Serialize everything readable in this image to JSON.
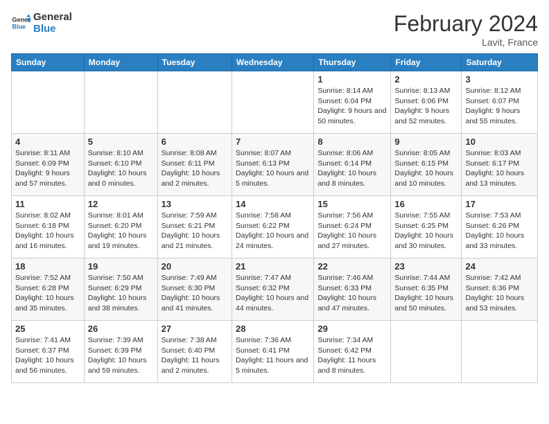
{
  "header": {
    "logo_general": "General",
    "logo_blue": "Blue",
    "month_title": "February 2024",
    "location": "Lavit, France"
  },
  "days_of_week": [
    "Sunday",
    "Monday",
    "Tuesday",
    "Wednesday",
    "Thursday",
    "Friday",
    "Saturday"
  ],
  "weeks": [
    [
      {
        "day": "",
        "info": ""
      },
      {
        "day": "",
        "info": ""
      },
      {
        "day": "",
        "info": ""
      },
      {
        "day": "",
        "info": ""
      },
      {
        "day": "1",
        "info": "Sunrise: 8:14 AM\nSunset: 6:04 PM\nDaylight: 9 hours and 50 minutes."
      },
      {
        "day": "2",
        "info": "Sunrise: 8:13 AM\nSunset: 6:06 PM\nDaylight: 9 hours and 52 minutes."
      },
      {
        "day": "3",
        "info": "Sunrise: 8:12 AM\nSunset: 6:07 PM\nDaylight: 9 hours and 55 minutes."
      }
    ],
    [
      {
        "day": "4",
        "info": "Sunrise: 8:11 AM\nSunset: 6:09 PM\nDaylight: 9 hours and 57 minutes."
      },
      {
        "day": "5",
        "info": "Sunrise: 8:10 AM\nSunset: 6:10 PM\nDaylight: 10 hours and 0 minutes."
      },
      {
        "day": "6",
        "info": "Sunrise: 8:08 AM\nSunset: 6:11 PM\nDaylight: 10 hours and 2 minutes."
      },
      {
        "day": "7",
        "info": "Sunrise: 8:07 AM\nSunset: 6:13 PM\nDaylight: 10 hours and 5 minutes."
      },
      {
        "day": "8",
        "info": "Sunrise: 8:06 AM\nSunset: 6:14 PM\nDaylight: 10 hours and 8 minutes."
      },
      {
        "day": "9",
        "info": "Sunrise: 8:05 AM\nSunset: 6:15 PM\nDaylight: 10 hours and 10 minutes."
      },
      {
        "day": "10",
        "info": "Sunrise: 8:03 AM\nSunset: 6:17 PM\nDaylight: 10 hours and 13 minutes."
      }
    ],
    [
      {
        "day": "11",
        "info": "Sunrise: 8:02 AM\nSunset: 6:18 PM\nDaylight: 10 hours and 16 minutes."
      },
      {
        "day": "12",
        "info": "Sunrise: 8:01 AM\nSunset: 6:20 PM\nDaylight: 10 hours and 19 minutes."
      },
      {
        "day": "13",
        "info": "Sunrise: 7:59 AM\nSunset: 6:21 PM\nDaylight: 10 hours and 21 minutes."
      },
      {
        "day": "14",
        "info": "Sunrise: 7:58 AM\nSunset: 6:22 PM\nDaylight: 10 hours and 24 minutes."
      },
      {
        "day": "15",
        "info": "Sunrise: 7:56 AM\nSunset: 6:24 PM\nDaylight: 10 hours and 27 minutes."
      },
      {
        "day": "16",
        "info": "Sunrise: 7:55 AM\nSunset: 6:25 PM\nDaylight: 10 hours and 30 minutes."
      },
      {
        "day": "17",
        "info": "Sunrise: 7:53 AM\nSunset: 6:26 PM\nDaylight: 10 hours and 33 minutes."
      }
    ],
    [
      {
        "day": "18",
        "info": "Sunrise: 7:52 AM\nSunset: 6:28 PM\nDaylight: 10 hours and 35 minutes."
      },
      {
        "day": "19",
        "info": "Sunrise: 7:50 AM\nSunset: 6:29 PM\nDaylight: 10 hours and 38 minutes."
      },
      {
        "day": "20",
        "info": "Sunrise: 7:49 AM\nSunset: 6:30 PM\nDaylight: 10 hours and 41 minutes."
      },
      {
        "day": "21",
        "info": "Sunrise: 7:47 AM\nSunset: 6:32 PM\nDaylight: 10 hours and 44 minutes."
      },
      {
        "day": "22",
        "info": "Sunrise: 7:46 AM\nSunset: 6:33 PM\nDaylight: 10 hours and 47 minutes."
      },
      {
        "day": "23",
        "info": "Sunrise: 7:44 AM\nSunset: 6:35 PM\nDaylight: 10 hours and 50 minutes."
      },
      {
        "day": "24",
        "info": "Sunrise: 7:42 AM\nSunset: 6:36 PM\nDaylight: 10 hours and 53 minutes."
      }
    ],
    [
      {
        "day": "25",
        "info": "Sunrise: 7:41 AM\nSunset: 6:37 PM\nDaylight: 10 hours and 56 minutes."
      },
      {
        "day": "26",
        "info": "Sunrise: 7:39 AM\nSunset: 6:39 PM\nDaylight: 10 hours and 59 minutes."
      },
      {
        "day": "27",
        "info": "Sunrise: 7:38 AM\nSunset: 6:40 PM\nDaylight: 11 hours and 2 minutes."
      },
      {
        "day": "28",
        "info": "Sunrise: 7:36 AM\nSunset: 6:41 PM\nDaylight: 11 hours and 5 minutes."
      },
      {
        "day": "29",
        "info": "Sunrise: 7:34 AM\nSunset: 6:42 PM\nDaylight: 11 hours and 8 minutes."
      },
      {
        "day": "",
        "info": ""
      },
      {
        "day": "",
        "info": ""
      }
    ]
  ]
}
